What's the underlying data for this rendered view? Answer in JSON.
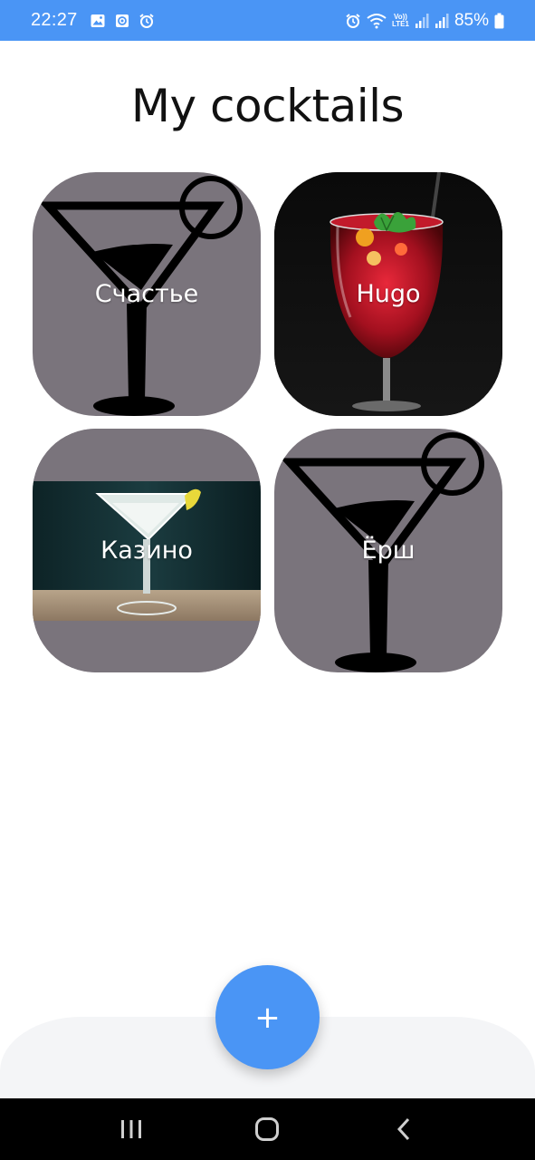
{
  "status_bar": {
    "time": "22:27",
    "battery_percent": "85%",
    "network_label": "Vo)) LTE1",
    "left_icons": [
      "image-icon",
      "sync-icon",
      "alarm-icon"
    ],
    "right_icons": [
      "alarm-icon",
      "wifi-icon",
      "lte-icon",
      "signal-icon",
      "signal-icon",
      "battery-icon"
    ]
  },
  "page": {
    "title": "My cocktails"
  },
  "cocktails": [
    {
      "name": "Счастье",
      "image": "martini-placeholder-icon"
    },
    {
      "name": "Hugo",
      "image": "red-cocktail-photo"
    },
    {
      "name": "Казино",
      "image": "martini-glass-photo"
    },
    {
      "name": "Ёрш",
      "image": "martini-placeholder-icon"
    }
  ],
  "fab": {
    "label": "+",
    "icon": "add-icon"
  },
  "nav_bar": {
    "buttons": [
      "recent-apps-icon",
      "home-icon",
      "back-icon"
    ]
  },
  "colors": {
    "accent": "#4a95f5",
    "card_gray": "#7a747c",
    "bottom_bar": "#f4f5f7"
  }
}
